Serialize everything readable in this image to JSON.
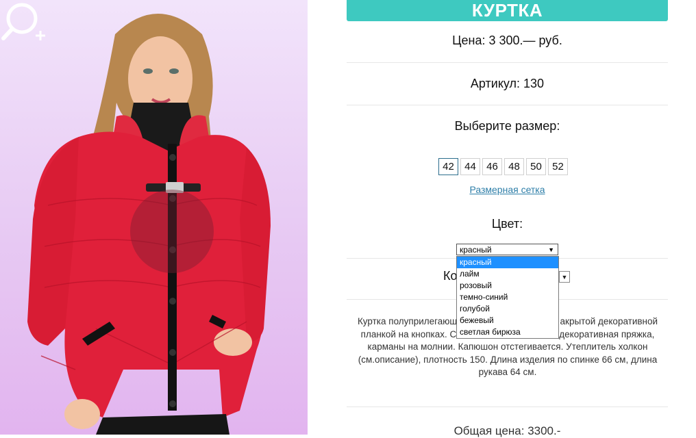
{
  "product": {
    "title": "КУРТКА",
    "price": "Цена: 3 300.— руб.",
    "article": "Артикул: 130",
    "size_heading": "Выберите размер:",
    "sizes": [
      "42",
      "44",
      "46",
      "48",
      "50",
      "52"
    ],
    "selected_size": "42",
    "size_chart_link": "Размерная сетка",
    "color_heading": "Цвет:",
    "color_select": {
      "value": "красный",
      "options": [
        "красный",
        "лайм",
        "розовый",
        "темно-синий",
        "голубой",
        "бежевый",
        "светлая бирюза"
      ]
    },
    "quantity_label_partial": "Ко",
    "description_lines": [
      "Куртка полуприлегающ",
      "акрытой декоративной",
      "планкой на кнопках. С",
      "декоративная пряжка,",
      "карманы на молнии. Капюшон отстегивается. Утеплитель холкон",
      "(см.описание), плотность 150. Длина изделия по спинке 66 см, длина",
      "рукава 64 см."
    ],
    "total": "Общая цена: 3300.-"
  },
  "colors": {
    "accent": "#3ec9c0",
    "link": "#2d7ea8",
    "dropdown_highlight": "#1e90ff",
    "jacket": "#e0203a"
  },
  "icons": {
    "zoom": "zoom-in-icon"
  }
}
